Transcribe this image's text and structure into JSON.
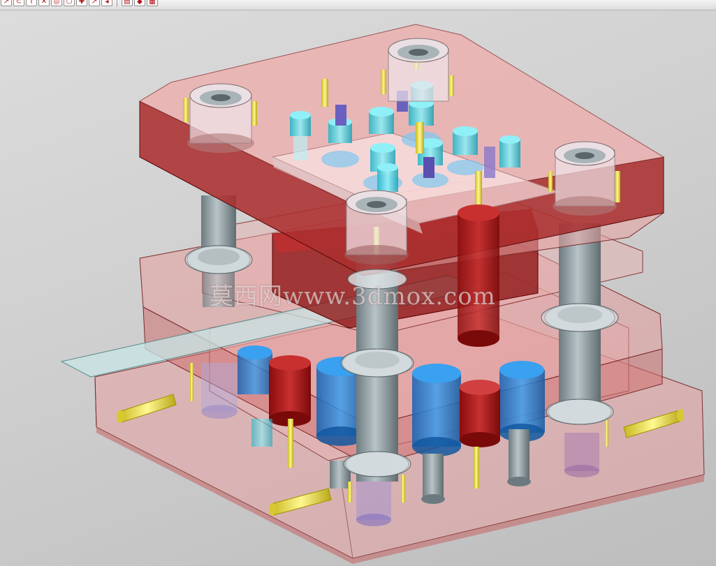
{
  "toolbar": {
    "buttons": [
      {
        "name": "sketch-line-tool",
        "glyph": "↗"
      },
      {
        "name": "arc-tool",
        "glyph": "⊂"
      },
      {
        "name": "spline-tool",
        "glyph": "⌇"
      },
      {
        "name": "trim-tool",
        "glyph": "✕"
      },
      {
        "name": "circle-tool",
        "glyph": "◎"
      },
      {
        "name": "polygon-tool",
        "glyph": "⬡"
      },
      {
        "name": "point-tool",
        "glyph": "✚"
      },
      {
        "name": "dimension-tool",
        "glyph": "↗"
      },
      {
        "name": "view-tool",
        "glyph": "◂"
      }
    ],
    "extra_buttons": [
      {
        "name": "layer-tool",
        "glyph": "▤"
      },
      {
        "name": "shaded-view-tool",
        "glyph": "◆"
      },
      {
        "name": "grid-view-tool",
        "glyph": "▦"
      }
    ]
  },
  "viewport": {
    "model": "progressive die assembly",
    "colors": {
      "plate_fill": "#e89a9a",
      "plate_side": "#a01818",
      "guide_post": "#8c9aa0",
      "punch_cyan": "#36d0e0",
      "punch_blue": "#1e7ed8",
      "pin_yellow": "#f0e040",
      "strip": "#c8e6e6"
    }
  },
  "watermark": {
    "text": "莫西网www.3dmox.com"
  }
}
